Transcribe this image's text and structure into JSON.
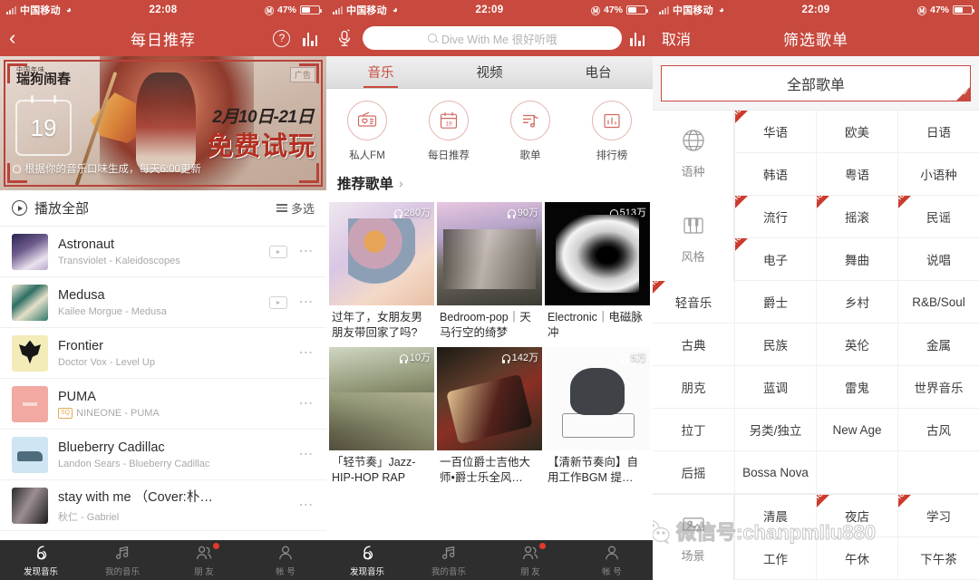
{
  "theme": {
    "brand_red": "#c8493e",
    "accent_hot": "#cc3b2d",
    "tabbar_bg": "#2e2e2e"
  },
  "panel1": {
    "status": {
      "carrier": "中国移动",
      "wifi_icon": "wifi-icon",
      "time": "22:08",
      "battery_percent": "47%",
      "lock_icon": "rotation-lock-icon"
    },
    "nav": {
      "back_icon": "back-chevron-icon",
      "title": "每日推荐",
      "help_icon": "question-mark-icon",
      "eq_icon": "equalizer-icon"
    },
    "banner": {
      "brand_main": "瑞狗闹春",
      "brand_sub": "中国年味",
      "ad_tag": "广告",
      "calendar_day": "19",
      "dates": "2月10日-21日",
      "headline": "免费试玩",
      "note": "根据你的音乐口味生成，每天6:00更新"
    },
    "playall": {
      "label": "播放全部",
      "multi_select": "多选",
      "play_icon": "play-circle-icon",
      "list-icon": "list-icon"
    },
    "songs": [
      {
        "title": "Astronaut",
        "subtitle": "Transviolet - Kaleidoscopes",
        "cover": "cv-1",
        "has_mv": true,
        "sq": false
      },
      {
        "title": "Medusa",
        "subtitle": "Kailee Morgue - Medusa",
        "cover": "cv-2",
        "has_mv": true,
        "sq": false
      },
      {
        "title": "Frontier",
        "subtitle": "Doctor Vox - Level Up",
        "cover": "cv-3",
        "has_mv": false,
        "sq": false
      },
      {
        "title": "PUMA",
        "subtitle": "NINEONE - PUMA",
        "cover": "cv-4",
        "has_mv": false,
        "sq": true,
        "sq_label": "SQ"
      },
      {
        "title": "Blueberry Cadillac",
        "subtitle": "Landon Sears - Blueberry Cadillac",
        "cover": "cv-5",
        "has_mv": false,
        "sq": false
      },
      {
        "title": "stay with me （Cover:朴…",
        "subtitle": "秋仁 - Gabriel",
        "cover": "cv-6",
        "has_mv": false,
        "sq": false
      }
    ],
    "tabbar": [
      {
        "label": "发现音乐",
        "icon": "netease-logo-icon",
        "active": true,
        "badge": false
      },
      {
        "label": "我的音乐",
        "icon": "music-note-icon",
        "active": false,
        "badge": false
      },
      {
        "label": "朋 友",
        "icon": "friends-icon",
        "active": false,
        "badge": true
      },
      {
        "label": "帐 号",
        "icon": "account-icon",
        "active": false,
        "badge": false
      }
    ]
  },
  "panel2": {
    "status": {
      "carrier": "中国移动",
      "time": "22:09",
      "battery_percent": "47%"
    },
    "search": {
      "mic_icon": "voice-search-icon",
      "search_icon": "search-icon",
      "placeholder": "Dive With Me 很好听哦",
      "value": "",
      "eq_icon": "equalizer-icon"
    },
    "tabs": [
      {
        "label": "音乐",
        "active": true
      },
      {
        "label": "视频",
        "active": false
      },
      {
        "label": "电台",
        "active": false
      }
    ],
    "quick_entries": [
      {
        "label": "私人FM",
        "icon": "radio-heart-icon"
      },
      {
        "label": "每日推荐",
        "icon": "calendar-19-icon"
      },
      {
        "label": "歌单",
        "icon": "playlist-note-icon"
      },
      {
        "label": "排行榜",
        "icon": "bar-chart-icon"
      }
    ],
    "section": {
      "title": "推荐歌单",
      "chevron_icon": "chevron-right-icon"
    },
    "playlists": [
      {
        "title": "过年了，女朋友男朋友带回家了吗?",
        "plays": "280万",
        "img": "im-a"
      },
      {
        "title": "Bedroom-pop｜天马行空的绮梦",
        "plays": "90万",
        "img": "im-b"
      },
      {
        "title": "Electronic｜电磁脉冲",
        "plays": "513万",
        "img": "im-c"
      },
      {
        "title": "「轻节奏」Jazz-HIP-HOP RAP",
        "plays": "10万",
        "img": "im-d"
      },
      {
        "title": "一百位爵士吉他大师•爵士乐全风…",
        "plays": "142万",
        "img": "im-e"
      },
      {
        "title": "【清新节奏向】自用工作BGM 提…",
        "plays": "5万",
        "img": "im-f"
      }
    ],
    "tabbar": [
      {
        "label": "发现音乐",
        "icon": "netease-logo-icon",
        "active": true,
        "badge": false
      },
      {
        "label": "我的音乐",
        "icon": "music-note-icon",
        "active": false,
        "badge": false
      },
      {
        "label": "朋 友",
        "icon": "friends-icon",
        "active": false,
        "badge": true
      },
      {
        "label": "帐 号",
        "icon": "account-icon",
        "active": false,
        "badge": false
      }
    ]
  },
  "panel3": {
    "status": {
      "carrier": "中国移动",
      "time": "22:09",
      "battery_percent": "47%"
    },
    "nav": {
      "cancel": "取消",
      "title": "筛选歌单"
    },
    "all_playlists": {
      "label": "全部歌单",
      "selected": true,
      "check_icon": "check-corner-icon"
    },
    "filters": [
      {
        "group": "语种",
        "icon": "globe-icon",
        "columns": 3,
        "items": [
          {
            "label": "华语",
            "hot": true
          },
          {
            "label": "欧美",
            "hot": false
          },
          {
            "label": "日语",
            "hot": false
          },
          {
            "label": "韩语",
            "hot": false
          },
          {
            "label": "粤语",
            "hot": false
          },
          {
            "label": "小语种",
            "hot": false
          }
        ]
      },
      {
        "group": "风格",
        "icon": "piano-keys-icon",
        "columns": 4,
        "top_items": [
          {
            "label": "流行",
            "hot": true
          },
          {
            "label": "摇滚",
            "hot": true
          },
          {
            "label": "民谣",
            "hot": true
          },
          {
            "label": "电子",
            "hot": true
          },
          {
            "label": "舞曲",
            "hot": false
          },
          {
            "label": "说唱",
            "hot": false
          }
        ],
        "items": [
          {
            "label": "轻音乐",
            "hot": true
          },
          {
            "label": "爵士",
            "hot": false
          },
          {
            "label": "乡村",
            "hot": false
          },
          {
            "label": "R&B/Soul",
            "hot": false
          },
          {
            "label": "古典",
            "hot": false
          },
          {
            "label": "民族",
            "hot": false
          },
          {
            "label": "英伦",
            "hot": false
          },
          {
            "label": "金属",
            "hot": false
          },
          {
            "label": "朋克",
            "hot": false
          },
          {
            "label": "蓝调",
            "hot": false
          },
          {
            "label": "雷鬼",
            "hot": false
          },
          {
            "label": "世界音乐",
            "hot": false
          },
          {
            "label": "拉丁",
            "hot": false
          },
          {
            "label": "另类/独立",
            "hot": false
          },
          {
            "label": "New Age",
            "hot": false
          },
          {
            "label": "古风",
            "hot": false
          },
          {
            "label": "后摇",
            "hot": false
          },
          {
            "label": "Bossa Nova",
            "hot": false
          },
          {
            "label": "",
            "hot": false
          },
          {
            "label": "",
            "hot": false
          }
        ]
      },
      {
        "group": "场景",
        "icon": "scene-icon",
        "columns": 3,
        "items": [
          {
            "label": "清晨",
            "hot": false
          },
          {
            "label": "夜店",
            "hot": true
          },
          {
            "label": "学习",
            "hot": true
          },
          {
            "label": "工作",
            "hot": false
          },
          {
            "label": "午休",
            "hot": false
          },
          {
            "label": "下午茶",
            "hot": false
          }
        ]
      }
    ],
    "watermark": {
      "text": "微信号:chanpmliu880",
      "icon": "wechat-logo-icon"
    }
  }
}
